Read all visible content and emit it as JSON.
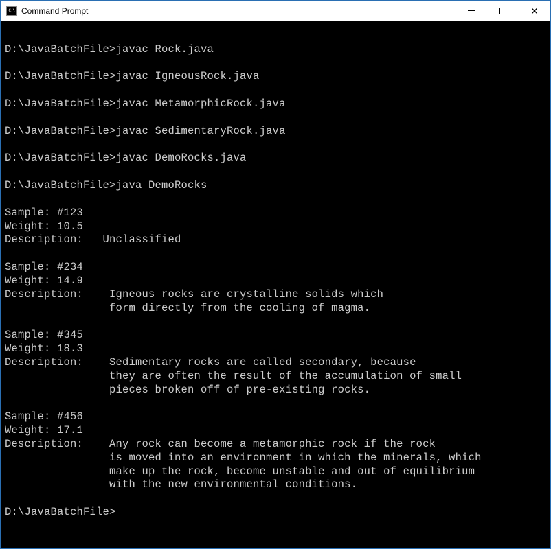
{
  "titlebar": {
    "icon_text": "C:\\",
    "title": "Command Prompt"
  },
  "terminal": {
    "content": "\nD:\\JavaBatchFile>javac Rock.java\n\nD:\\JavaBatchFile>javac IgneousRock.java\n\nD:\\JavaBatchFile>javac MetamorphicRock.java\n\nD:\\JavaBatchFile>javac SedimentaryRock.java\n\nD:\\JavaBatchFile>javac DemoRocks.java\n\nD:\\JavaBatchFile>java DemoRocks\n\nSample: #123\nWeight: 10.5\nDescription:   Unclassified\n\nSample: #234\nWeight: 14.9\nDescription:    Igneous rocks are crystalline solids which\n                form directly from the cooling of magma.\n\nSample: #345\nWeight: 18.3\nDescription:    Sedimentary rocks are called secondary, because\n                they are often the result of the accumulation of small\n                pieces broken off of pre-existing rocks.\n\nSample: #456\nWeight: 17.1\nDescription:    Any rock can become a metamorphic rock if the rock\n                is moved into an environment in which the minerals, which\n                make up the rock, become unstable and out of equilibrium\n                with the new environmental conditions.\n\nD:\\JavaBatchFile>"
  }
}
